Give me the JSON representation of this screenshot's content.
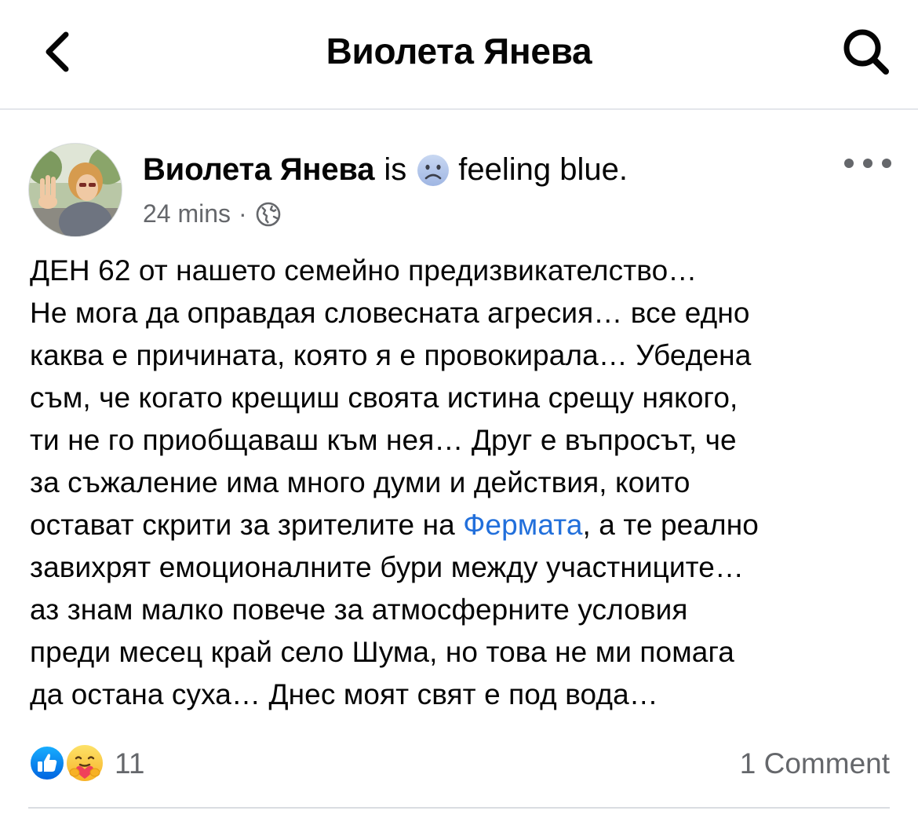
{
  "nav": {
    "title": "Виолета Янева",
    "back_icon": "chevron-left-icon",
    "search_icon": "search-icon"
  },
  "post": {
    "author": "Виолета Янева",
    "is_text": "is",
    "feeling_emoji": "sad-face-emoji",
    "feeling": "feeling blue.",
    "time": "24 mins",
    "separator": "·",
    "privacy_icon": "globe-icon",
    "more_icon": "more-horizontal-icon",
    "body_lines": [
      "ДЕН 62 от нашето семейно предизвикателство…",
      "Не мога да оправдая словесната агресия… все едно",
      "каква е причината, която я е провокирала… Убедена",
      "съм, че когато крещиш своята истина срещу някого,",
      "ти не го приобщаваш към нея… Друг е въпросът, че",
      "за съжаление има много думи и действия, които"
    ],
    "line7_before": "остават скрити за зрителите на ",
    "line7_link": "Фермата",
    "line7_after": ", а те реално",
    "body_lines_end": [
      "завихрят емоционалните бури между участниците…",
      "аз знам малко повече за атмосферните условия",
      "преди месец край село Шума, но това не ми помага",
      "да остана суха… Днес моят свят е под вода…"
    ],
    "link_color": "#216fdb"
  },
  "reactions": {
    "icons": [
      "like-reaction-icon",
      "care-reaction-icon"
    ],
    "count": "11",
    "comments": "1 Comment"
  },
  "colors": {
    "text": "#050505",
    "secondary": "#65676b",
    "like_blue": "#1877f2",
    "divider": "#dadde1"
  }
}
